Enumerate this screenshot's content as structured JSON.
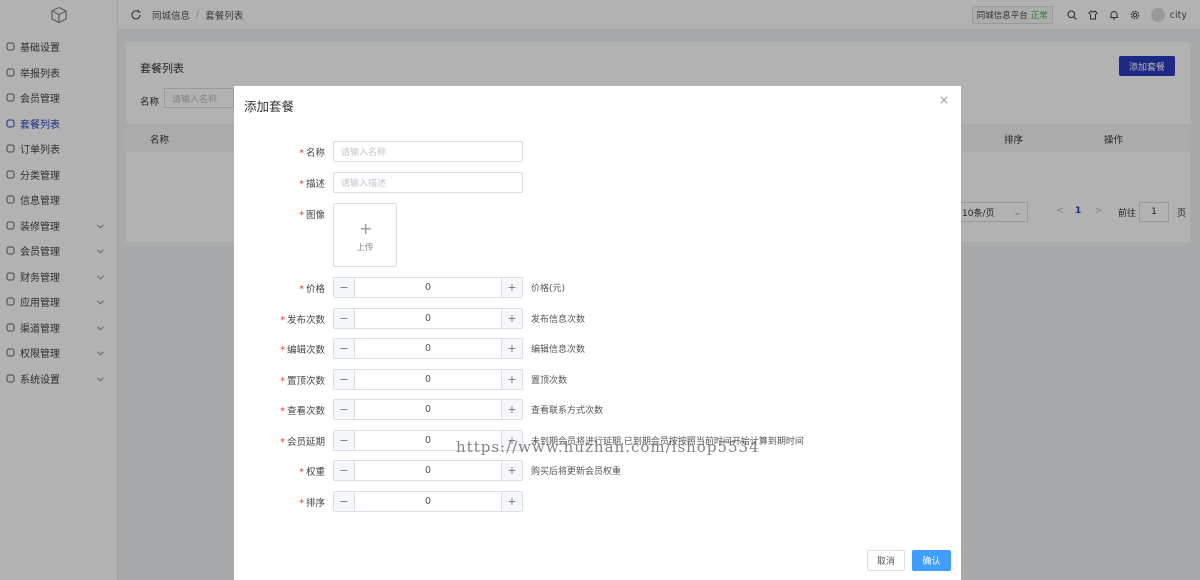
{
  "header": {
    "breadcrumb": [
      "同城信息",
      "/",
      "套餐列表"
    ],
    "platform_label": "同城信息平台",
    "platform_status": "正常",
    "username": "city"
  },
  "sidebar": {
    "items": [
      {
        "label": "基础设置",
        "icon": "settings-icon",
        "active": false,
        "has_children": false
      },
      {
        "label": "举报列表",
        "icon": "bell-icon",
        "active": false,
        "has_children": false
      },
      {
        "label": "会员管理",
        "icon": "vip-icon",
        "active": false,
        "has_children": false
      },
      {
        "label": "套餐列表",
        "icon": "gift-icon",
        "active": true,
        "has_children": false
      },
      {
        "label": "订单列表",
        "icon": "list-icon",
        "active": false,
        "has_children": false
      },
      {
        "label": "分类管理",
        "icon": "layers-icon",
        "active": false,
        "has_children": false
      },
      {
        "label": "信息管理",
        "icon": "document-icon",
        "active": false,
        "has_children": false
      },
      {
        "label": "装修管理",
        "icon": "brush-icon",
        "active": false,
        "has_children": true
      },
      {
        "label": "会员管理",
        "icon": "vip-icon",
        "active": false,
        "has_children": true
      },
      {
        "label": "财务管理",
        "icon": "wallet-icon",
        "active": false,
        "has_children": true
      },
      {
        "label": "应用管理",
        "icon": "app-icon",
        "active": false,
        "has_children": true
      },
      {
        "label": "渠道管理",
        "icon": "channel-icon",
        "active": false,
        "has_children": true
      },
      {
        "label": "权限管理",
        "icon": "lock-icon",
        "active": false,
        "has_children": true
      },
      {
        "label": "系统设置",
        "icon": "settings-icon",
        "active": false,
        "has_children": true
      }
    ]
  },
  "page": {
    "title": "套餐列表",
    "add_button": "添加套餐",
    "filter_label": "名称",
    "filter_placeholder": "请输入名称",
    "columns": [
      "名称",
      "排序",
      "操作"
    ],
    "pager": {
      "page_size": "10条/页",
      "prev": "<",
      "current": "1",
      "next": ">",
      "goto_label": "前往",
      "goto_value": "1",
      "unit": "页"
    }
  },
  "modal": {
    "title": "添加套餐",
    "close": "×",
    "fields": {
      "name": {
        "label": "名称",
        "placeholder": "请输入名称"
      },
      "desc": {
        "label": "描述",
        "placeholder": "请输入描述"
      },
      "image": {
        "label": "图像",
        "upload": "上传"
      }
    },
    "steppers": [
      {
        "label": "价格",
        "value": "0",
        "hint": "价格(元)"
      },
      {
        "label": "发布次数",
        "value": "0",
        "hint": "发布信息次数"
      },
      {
        "label": "编辑次数",
        "value": "0",
        "hint": "编辑信息次数"
      },
      {
        "label": "置顶次数",
        "value": "0",
        "hint": "置顶次数"
      },
      {
        "label": "查看次数",
        "value": "0",
        "hint": "查看联系方式次数"
      },
      {
        "label": "会员延期",
        "value": "0",
        "hint": "未到期会员将进行延期,已到期会员按按照当前时间开始计算到期时间"
      },
      {
        "label": "权重",
        "value": "0",
        "hint": "购买后将更新会员权重"
      },
      {
        "label": "排序",
        "value": "0",
        "hint": ""
      }
    ],
    "required_mark": "*",
    "minus": "−",
    "plus": "+",
    "cancel": "取消",
    "confirm": "确认"
  },
  "watermark": "https://www.huzhan.com/ishop5534",
  "colors": {
    "primary": "#2a3cbd",
    "confirm": "#409eff",
    "required": "#e53935",
    "status_ok": "#39b54a"
  }
}
